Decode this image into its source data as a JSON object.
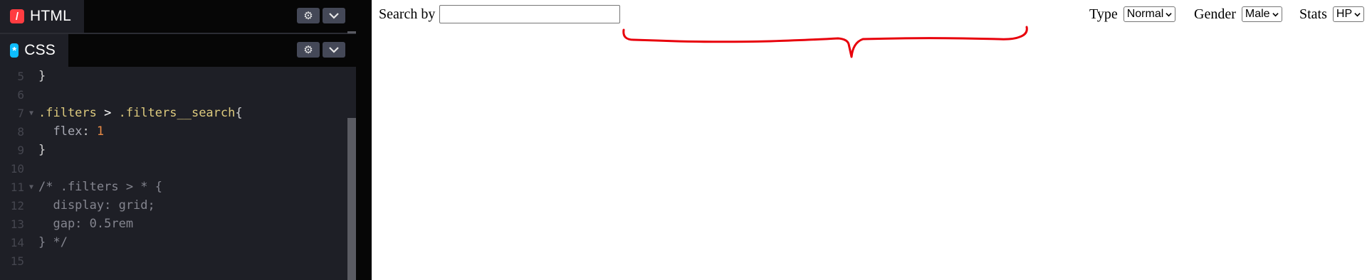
{
  "editor": {
    "html_tab": "HTML",
    "css_tab": "CSS",
    "settings_icon": "gear-icon",
    "collapse_icon": "chevron-down-icon",
    "lines": [
      {
        "n": "5",
        "code": "}"
      },
      {
        "n": "6",
        "code": ""
      },
      {
        "n": "7",
        "selector": ".filters",
        "mid": " > ",
        "selector2": ".filters__search",
        "tail": "{"
      },
      {
        "n": "8",
        "prop": "flex",
        "colon": ": ",
        "value": "1"
      },
      {
        "n": "9",
        "code": "}"
      },
      {
        "n": "10",
        "code": ""
      },
      {
        "n": "11",
        "comment": "/* .filters > * {"
      },
      {
        "n": "12",
        "comment": "  display: grid;"
      },
      {
        "n": "13",
        "comment": "  gap: 0.5rem"
      },
      {
        "n": "14",
        "comment": "} */"
      },
      {
        "n": "15",
        "code": ""
      }
    ]
  },
  "preview": {
    "search_label": "Search by",
    "search_value": "",
    "type_label": "Type",
    "type_value": "Normal",
    "gender_label": "Gender",
    "gender_value": "Male",
    "stats_label": "Stats",
    "stats_value": "HP"
  },
  "colors": {
    "annotation": "#e8000b",
    "html_icon": "#ff3c41",
    "css_icon": "#0ebeff"
  }
}
